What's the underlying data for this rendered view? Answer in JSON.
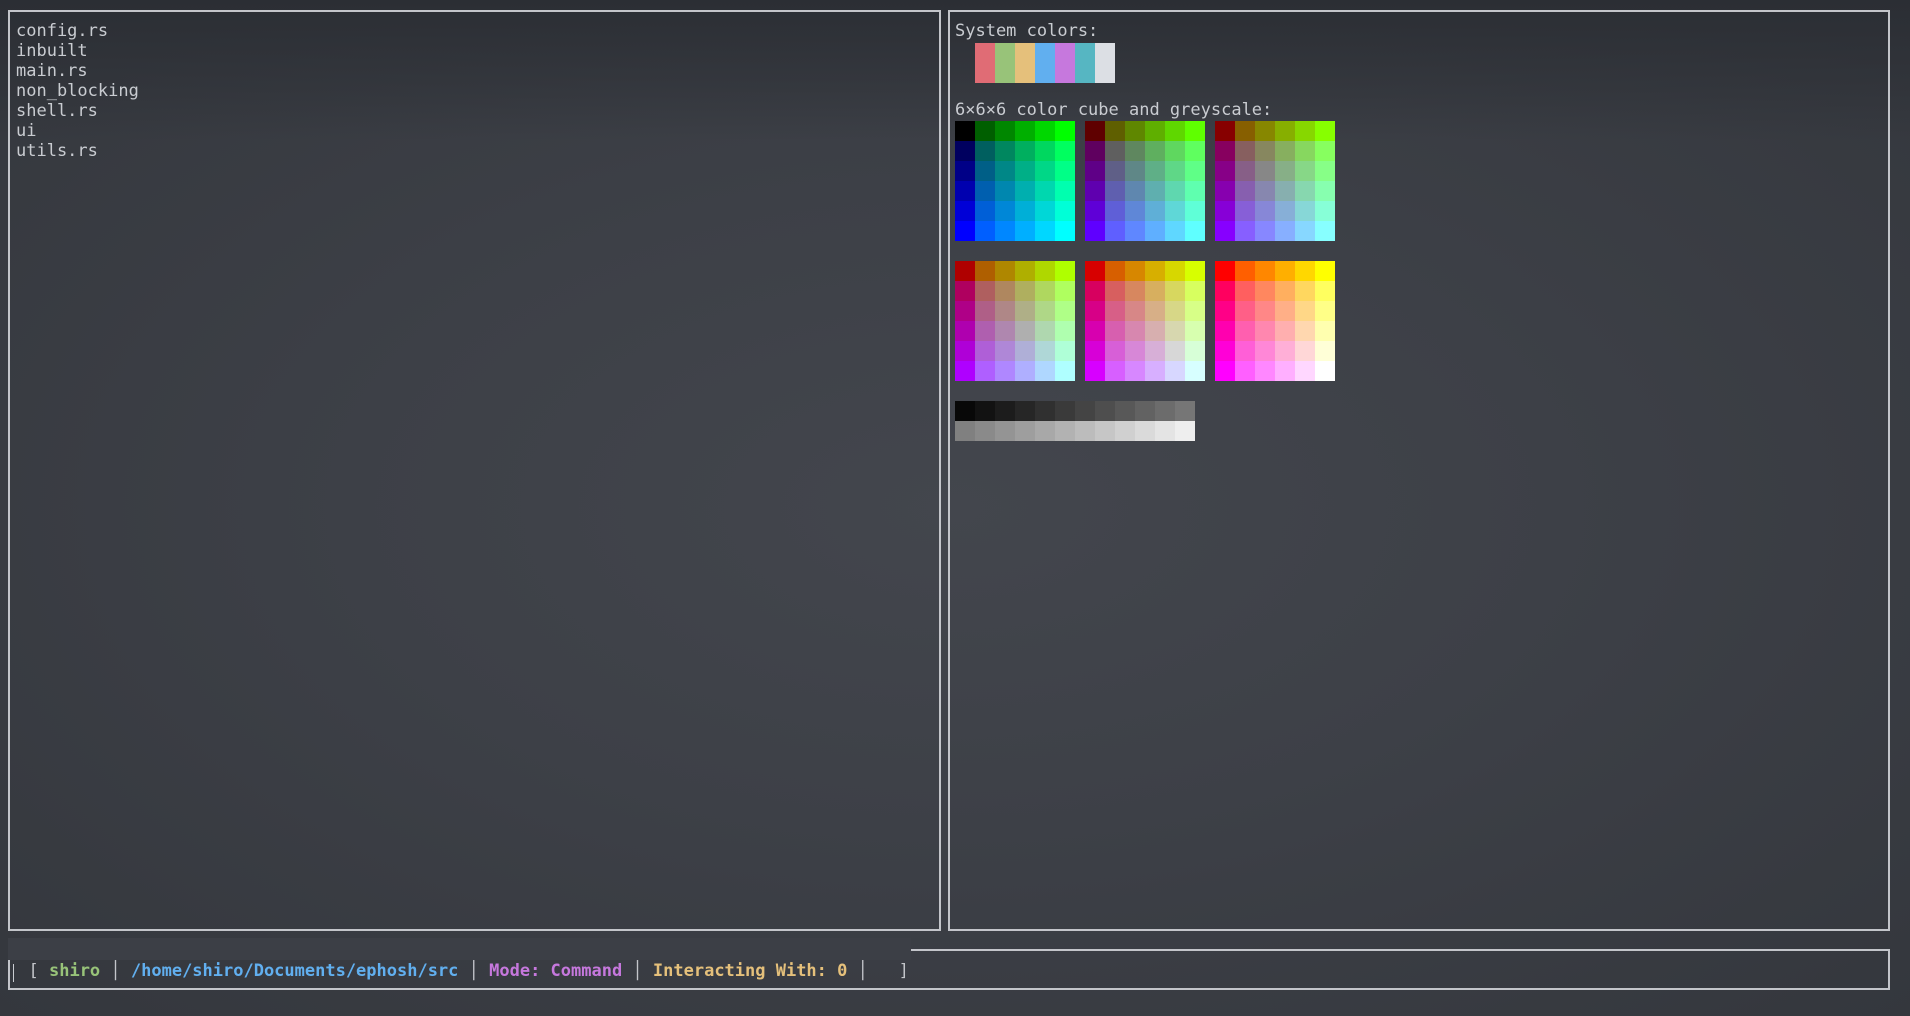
{
  "files": [
    "config.rs",
    "inbuilt",
    "main.rs",
    "non_blocking",
    "shell.rs",
    "ui",
    "utils.rs"
  ],
  "system_colors": {
    "label": "System colors:",
    "colors": [
      "#e06c75",
      "#98c379",
      "#e5c07b",
      "#61afef",
      "#c678dd",
      "#56b6c2",
      "#dcdfe4"
    ]
  },
  "cube": {
    "label": "6×6×6 color cube and greyscale:"
  },
  "status": {
    "open_bracket": "[",
    "user": "shiro",
    "user_color": "#98c379",
    "path": "/home/shiro/Documents/ephosh/src",
    "path_color": "#61afef",
    "mode": "Mode: Command",
    "mode_color": "#c678dd",
    "interacting": "Interacting With: 0",
    "interacting_color": "#e5c07b",
    "close_bracket": "]"
  },
  "command_input": {
    "value": ""
  }
}
